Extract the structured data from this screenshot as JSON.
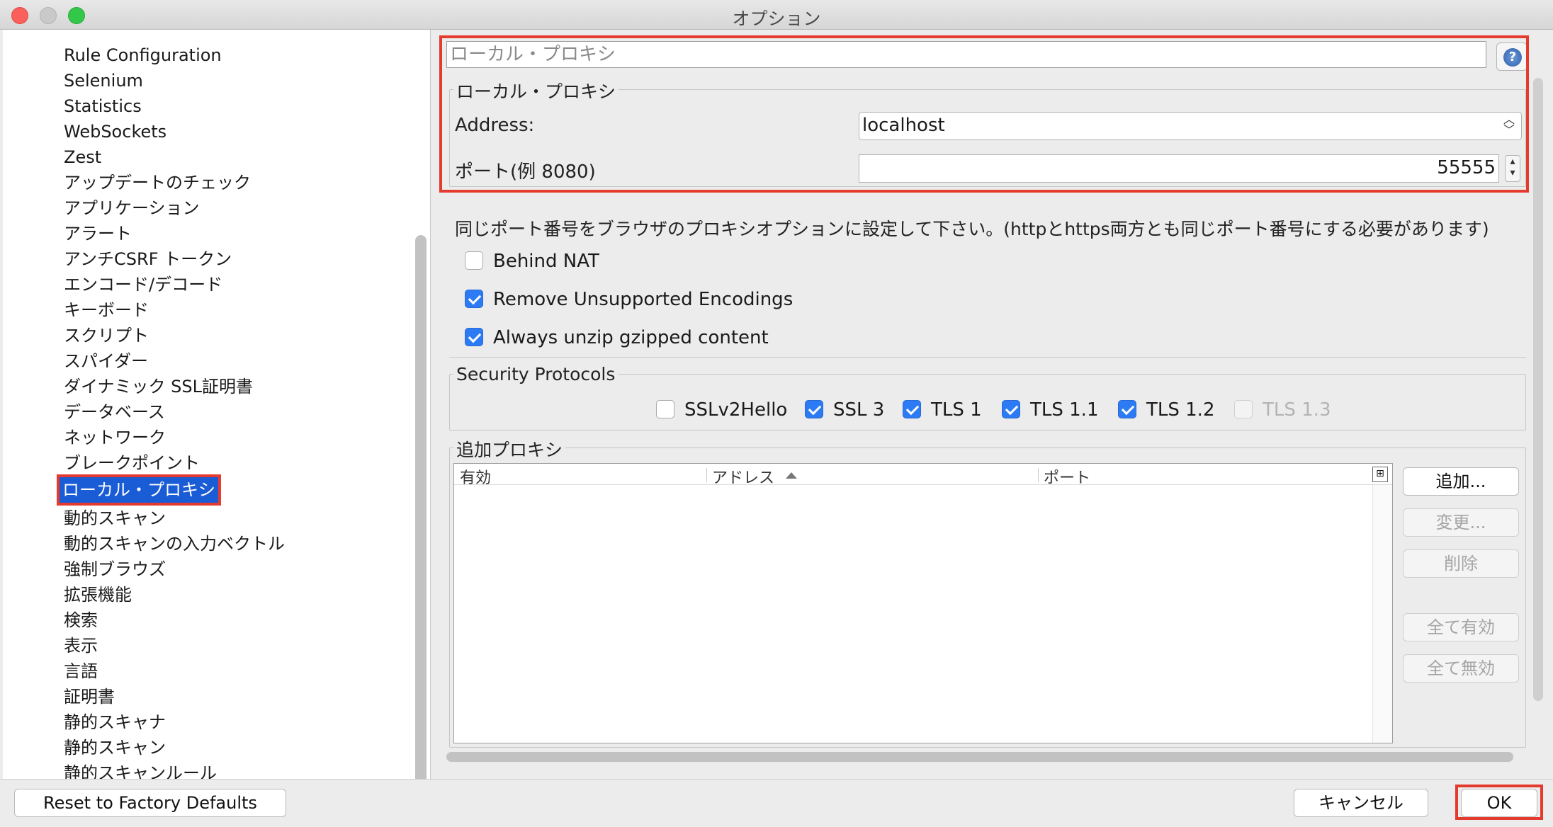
{
  "window": {
    "title": "オプション"
  },
  "sidebar": {
    "items": [
      "Rule Configuration",
      "Selenium",
      "Statistics",
      "WebSockets",
      "Zest",
      "アップデートのチェック",
      "アプリケーション",
      "アラート",
      "アンチCSRF トークン",
      "エンコード/デコード",
      "キーボード",
      "スクリプト",
      "スパイダー",
      "ダイナミック SSL証明書",
      "データベース",
      "ネットワーク",
      "ブレークポイント",
      "ローカル・プロキシ",
      "動的スキャン",
      "動的スキャンの入力ベクトル",
      "強制ブラウズ",
      "拡張機能",
      "検索",
      "表示",
      "言語",
      "証明書",
      "静的スキャナ",
      "静的スキャン",
      "静的スキャンルール"
    ],
    "selected": "ローカル・プロキシ"
  },
  "panel": {
    "header_title": "ローカル・プロキシ",
    "group_title": "ローカル・プロキシ",
    "address_label": "Address:",
    "address_value": "localhost",
    "port_label": "ポート(例 8080)",
    "port_value": "55555",
    "note": "同じポート番号をブラウザのプロキシオプションに設定して下さい。(httpとhttps両方とも同じポート番号にする必要があります)",
    "checkboxes": [
      {
        "label": "Behind NAT",
        "checked": false
      },
      {
        "label": "Remove Unsupported Encodings",
        "checked": true
      },
      {
        "label": "Always unzip gzipped content",
        "checked": true
      }
    ],
    "security": {
      "title": "Security Protocols",
      "protocols": [
        {
          "label": "SSLv2Hello",
          "checked": false,
          "enabled": true
        },
        {
          "label": "SSL 3",
          "checked": true,
          "enabled": true
        },
        {
          "label": "TLS 1",
          "checked": true,
          "enabled": true
        },
        {
          "label": "TLS 1.1",
          "checked": true,
          "enabled": true
        },
        {
          "label": "TLS 1.2",
          "checked": true,
          "enabled": true
        },
        {
          "label": "TLS 1.3",
          "checked": false,
          "enabled": false
        }
      ]
    },
    "extra_proxy": {
      "title": "追加プロキシ",
      "columns": [
        "有効",
        "アドレス",
        "ポート"
      ],
      "buttons": [
        {
          "label": "追加...",
          "enabled": true
        },
        {
          "label": "変更...",
          "enabled": false
        },
        {
          "label": "削除",
          "enabled": false
        },
        {
          "label": "全て有効",
          "enabled": false
        },
        {
          "label": "全て無効",
          "enabled": false
        }
      ]
    }
  },
  "footer": {
    "reset_label": "Reset to Factory Defaults",
    "cancel_label": "キャンセル",
    "ok_label": "OK"
  },
  "colors": {
    "accent": "#2d7bf4",
    "selection": "#1a5bd6",
    "highlight": "#e53a2e"
  }
}
